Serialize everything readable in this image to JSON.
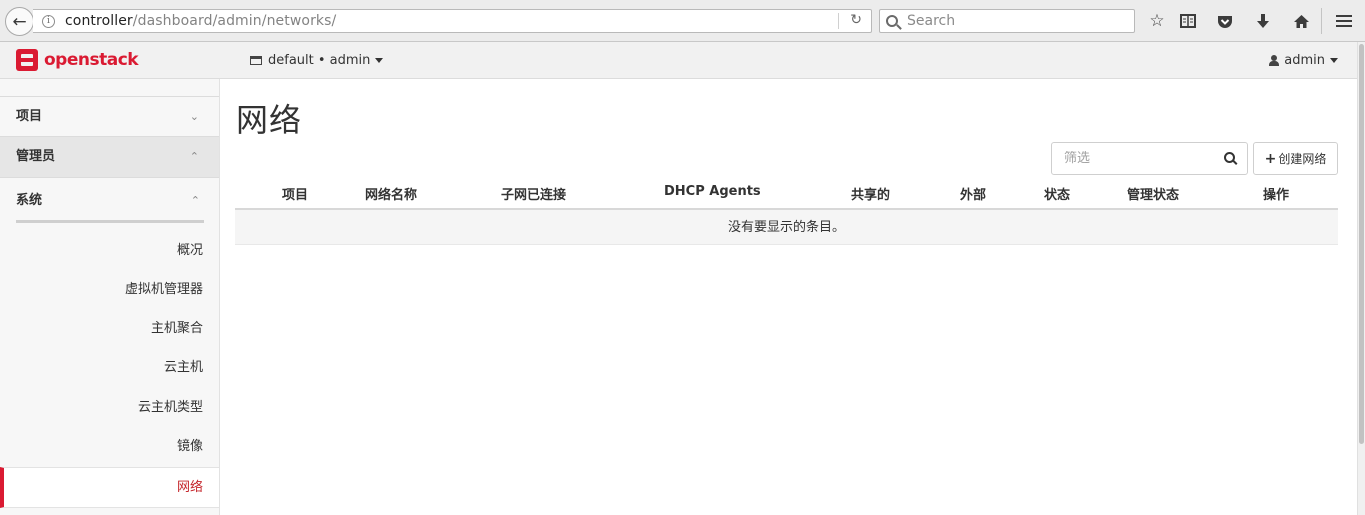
{
  "browser": {
    "url_host": "controller",
    "url_path": "/dashboard/admin/networks/",
    "search_placeholder": "Search"
  },
  "header": {
    "brand_open": "open",
    "brand_stack": "stack",
    "project_label": "default • admin",
    "user_label": "admin"
  },
  "sidebar": {
    "project": "项目",
    "admin": "管理员",
    "system": "系统",
    "items": [
      {
        "label": "概况"
      },
      {
        "label": "虚拟机管理器"
      },
      {
        "label": "主机聚合"
      },
      {
        "label": "云主机"
      },
      {
        "label": "云主机类型"
      },
      {
        "label": "镜像"
      },
      {
        "label": "网络",
        "active": true
      }
    ]
  },
  "main": {
    "title": "网络",
    "filter_placeholder": "筛选",
    "create_label": "创建网络",
    "columns": [
      "项目",
      "网络名称",
      "子网已连接",
      "DHCP Agents",
      "共享的",
      "外部",
      "状态",
      "管理状态",
      "操作"
    ],
    "empty_message": "没有要显示的条目。"
  },
  "colors": {
    "brand_red": "#da1a32",
    "active_text": "#c4242a"
  }
}
